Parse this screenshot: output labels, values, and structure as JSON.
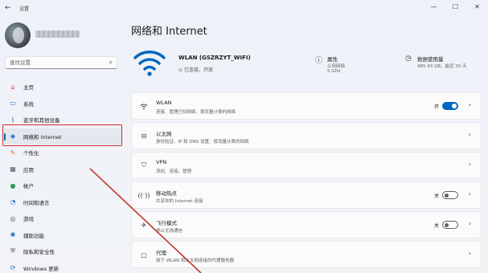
{
  "window": {
    "app_title": "设置",
    "minimize": "—",
    "maximize": "☐",
    "close": "✕"
  },
  "sidebar": {
    "search_placeholder": "查找设置",
    "items": [
      {
        "label": "主页",
        "icon": "home-icon",
        "glyph": "⌂",
        "color": "#c94f2a"
      },
      {
        "label": "系统",
        "icon": "system-icon",
        "glyph": "▭",
        "color": "#1f6fc1"
      },
      {
        "label": "蓝牙和其他设备",
        "icon": "bluetooth-icon",
        "glyph": "ᛒ",
        "color": "#1f6fc1"
      },
      {
        "label": "网络和 Internet",
        "icon": "network-icon",
        "glyph": "◆",
        "color": "#3a7bd5"
      },
      {
        "label": "个性化",
        "icon": "personalization-icon",
        "glyph": "✎",
        "color": "#c67a2b"
      },
      {
        "label": "应用",
        "icon": "apps-icon",
        "glyph": "▦",
        "color": "#4a5a6a"
      },
      {
        "label": "帐户",
        "icon": "accounts-icon",
        "glyph": "●",
        "color": "#2e9a5a"
      },
      {
        "label": "时间和语言",
        "icon": "time-language-icon",
        "glyph": "◔",
        "color": "#1f6fc1"
      },
      {
        "label": "游戏",
        "icon": "gaming-icon",
        "glyph": "◎",
        "color": "#555"
      },
      {
        "label": "辅助功能",
        "icon": "accessibility-icon",
        "glyph": "✱",
        "color": "#1f6fc1"
      },
      {
        "label": "隐私和安全性",
        "icon": "privacy-icon",
        "glyph": "⛨",
        "color": "#555"
      },
      {
        "label": "Windows 更新",
        "icon": "windows-update-icon",
        "glyph": "⟳",
        "color": "#1f6fc1"
      }
    ],
    "active_index": 3
  },
  "main": {
    "page_title": "网络和 Internet",
    "hero": {
      "ssid": "WLAN (GSZRZYT_WIFI)",
      "status": "已连接，开放",
      "properties": {
        "title": "属性",
        "sub1": "公用网络",
        "sub2": "5 GHz"
      },
      "data_usage": {
        "title": "数据使用量",
        "sub1": "485.43 GB，最近 30 天"
      }
    },
    "cards": [
      {
        "title": "WLAN",
        "sub": "连接、管理已知网络、按流量计费的网络",
        "icon": "wifi-icon",
        "toggle": "on",
        "toggle_label": "开"
      },
      {
        "title": "以太网",
        "sub": "身份验证、IP 和 DNS 设置、按流量计费的网络",
        "icon": "ethernet-icon",
        "chevron": "›"
      },
      {
        "title": "VPN",
        "sub": "添加、连接、管理",
        "icon": "vpn-icon",
        "chevron": "›"
      },
      {
        "title": "移动热点",
        "sub": "共享你的 Internet 连接",
        "icon": "hotspot-icon",
        "toggle": "off",
        "toggle_label": "关"
      },
      {
        "title": "飞行模式",
        "sub": "停止无线通信",
        "icon": "airplane-icon",
        "toggle": "off",
        "toggle_label": "关"
      },
      {
        "title": "代理",
        "sub": "用于 WLAN 和以太网连接的代理服务器",
        "icon": "proxy-icon",
        "chevron": "›"
      }
    ],
    "chevron": "›"
  }
}
